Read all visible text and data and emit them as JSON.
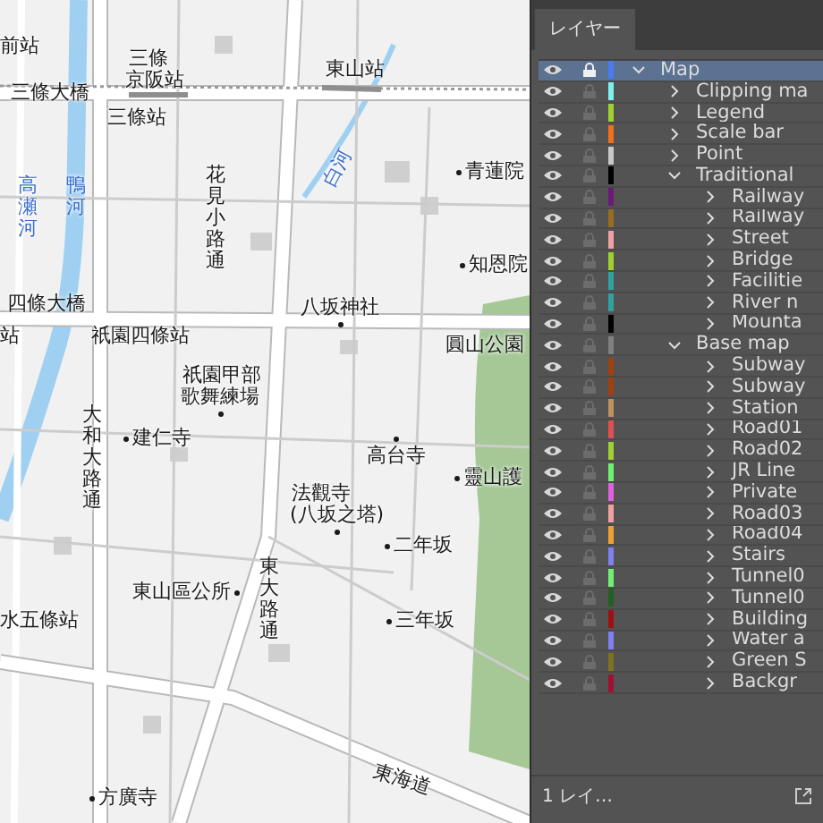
{
  "map": {
    "labels": [
      {
        "text": "前站",
        "kind": "station"
      },
      {
        "text": "三條",
        "kind": "station"
      },
      {
        "text": "京阪站",
        "kind": "station"
      },
      {
        "text": "東山站",
        "kind": "station"
      },
      {
        "text": "三條大橋",
        "kind": "place"
      },
      {
        "text": "三條站",
        "kind": "station"
      },
      {
        "text": "青蓮院",
        "kind": "poi"
      },
      {
        "text": "知恩院",
        "kind": "poi"
      },
      {
        "text": "高瀬河",
        "kind": "water-vertical"
      },
      {
        "text": "鴨河",
        "kind": "water-vertical"
      },
      {
        "text": "白河",
        "kind": "water-angled"
      },
      {
        "text": "花見小路通",
        "kind": "road-vertical"
      },
      {
        "text": "四條大橋",
        "kind": "place"
      },
      {
        "text": "站",
        "kind": "station"
      },
      {
        "text": "祇園四條站",
        "kind": "station"
      },
      {
        "text": "八坂神社",
        "kind": "poi-below"
      },
      {
        "text": "圓山公園",
        "kind": "place"
      },
      {
        "text": "祇園甲部",
        "kind": "place"
      },
      {
        "text": "歌舞練場",
        "kind": "poi-below"
      },
      {
        "text": "大和大路通",
        "kind": "road-vertical"
      },
      {
        "text": "建仁寺",
        "kind": "poi"
      },
      {
        "text": "高台寺",
        "kind": "poi-above"
      },
      {
        "text": "法觀寺",
        "kind": "place"
      },
      {
        "text": "(八坂之塔)",
        "kind": "poi-below"
      },
      {
        "text": "靈山護",
        "kind": "poi"
      },
      {
        "text": "二年坂",
        "kind": "poi"
      },
      {
        "text": "東大路通",
        "kind": "road-vertical"
      },
      {
        "text": "東山區公所",
        "kind": "poi-after"
      },
      {
        "text": "水五條站",
        "kind": "station"
      },
      {
        "text": "三年坂",
        "kind": "poi"
      },
      {
        "text": "東海道",
        "kind": "road-angled"
      },
      {
        "text": "方廣寺",
        "kind": "poi"
      }
    ]
  },
  "panel": {
    "tab": "レイヤー",
    "footer": "1 レイ…",
    "layers": [
      {
        "name": "Map",
        "color": "#4a7cf0",
        "selected": true,
        "expanded": true,
        "children": [
          {
            "name": "Clipping ma",
            "color": "#7ff0f0",
            "selected": false,
            "expanded": false
          },
          {
            "name": "Legend",
            "color": "#a0d030",
            "selected": false,
            "expanded": false
          },
          {
            "name": "Scale bar",
            "color": "#f07020",
            "selected": false,
            "expanded": false
          },
          {
            "name": "Point",
            "color": "#c8c8c8",
            "selected": false,
            "expanded": false
          },
          {
            "name": "Traditional",
            "color": "#000000",
            "selected": false,
            "expanded": true,
            "children": [
              {
                "name": "Railway",
                "color": "#6a1a7a",
                "selected": false,
                "expanded": false
              },
              {
                "name": "Railway",
                "color": "#9a6a20",
                "selected": false,
                "expanded": false
              },
              {
                "name": "Street",
                "color": "#f0a0a0",
                "selected": false,
                "expanded": false
              },
              {
                "name": "Bridge",
                "color": "#a0d030",
                "selected": false,
                "expanded": false
              },
              {
                "name": "Facilitie",
                "color": "#30a0a0",
                "selected": false,
                "expanded": false
              },
              {
                "name": "River n",
                "color": "#30a0a0",
                "selected": false,
                "expanded": false
              },
              {
                "name": "Mounta",
                "color": "#000000",
                "selected": false,
                "expanded": false
              }
            ]
          },
          {
            "name": "Base map",
            "color": "#808080",
            "selected": false,
            "expanded": true,
            "children": [
              {
                "name": "Subway",
                "color": "#a04010",
                "selected": false,
                "expanded": false
              },
              {
                "name": "Subway",
                "color": "#a04010",
                "selected": false,
                "expanded": false
              },
              {
                "name": "Station",
                "color": "#c09060",
                "selected": false,
                "expanded": false
              },
              {
                "name": "Road01",
                "color": "#e05050",
                "selected": false,
                "expanded": false
              },
              {
                "name": "Road02",
                "color": "#a0d030",
                "selected": false,
                "expanded": false
              },
              {
                "name": "JR Line",
                "color": "#70f070",
                "selected": false,
                "expanded": false
              },
              {
                "name": "Private",
                "color": "#e060e0",
                "selected": false,
                "expanded": false
              },
              {
                "name": "Road03",
                "color": "#f0a0a0",
                "selected": false,
                "expanded": false
              },
              {
                "name": "Road04",
                "color": "#f0a030",
                "selected": false,
                "expanded": false
              },
              {
                "name": "Stairs",
                "color": "#8080f0",
                "selected": false,
                "expanded": false
              },
              {
                "name": "Tunnel0",
                "color": "#70f070",
                "selected": false,
                "expanded": false
              },
              {
                "name": "Tunnel0",
                "color": "#206020",
                "selected": false,
                "expanded": false
              },
              {
                "name": "Building",
                "color": "#a01010",
                "selected": false,
                "expanded": false
              },
              {
                "name": "Water a",
                "color": "#8080f0",
                "selected": false,
                "expanded": false
              },
              {
                "name": "Green S",
                "color": "#807020",
                "selected": false,
                "expanded": false
              },
              {
                "name": "Backgr",
                "color": "#a01030",
                "selected": false,
                "expanded": false
              }
            ]
          }
        ]
      }
    ]
  }
}
